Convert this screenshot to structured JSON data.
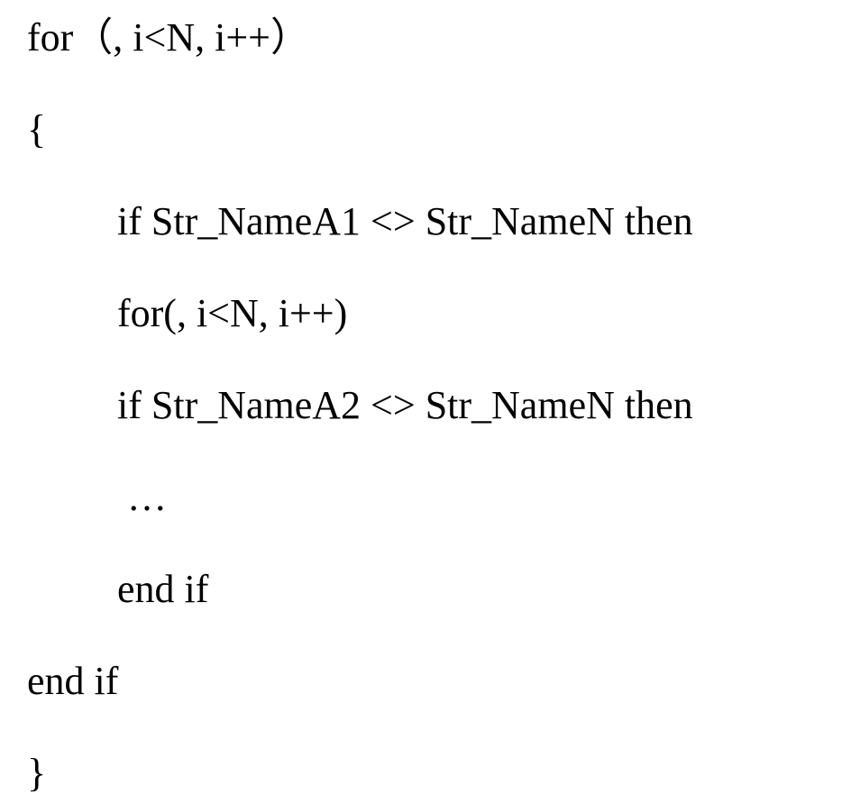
{
  "code": {
    "line1": "for（, i<N, i++）",
    "line2": "{",
    "line3": "if Str_NameA1 <> Str_NameN then",
    "line4": "for(, i<N, i++)",
    "line5": "if Str_NameA2 <> Str_NameN then",
    "line6": " …",
    "line7": "end if",
    "line8": "end if",
    "line9": "}"
  }
}
